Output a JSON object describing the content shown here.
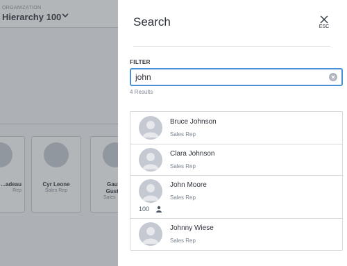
{
  "background": {
    "org_label": "ORGANIZATION",
    "org_name": "Hierarchy 100",
    "cards": [
      {
        "name": "...adeau",
        "role": "Rep"
      },
      {
        "name": "Cyr Leone",
        "role": "Sales Rep"
      },
      {
        "name": "Gauv Gusta",
        "role": "Sales"
      }
    ]
  },
  "panel": {
    "title": "Search",
    "close_label": "ESC",
    "filter_label": "FILTER",
    "filter_value": "john",
    "results_count": "4 Results",
    "results": [
      {
        "name": "Bruce Johnson",
        "role": "Sales Rep"
      },
      {
        "name": "Clara Johnson",
        "role": "Sales Rep"
      },
      {
        "name": "John Moore",
        "role": "Sales Rep",
        "count": "100"
      },
      {
        "name": "Johnny Wiese",
        "role": "Sales Rep"
      }
    ]
  },
  "colors": {
    "accent": "#4a90d9",
    "overlay": "#4b5058",
    "avatar": "#c5cad2"
  },
  "icons": {
    "close": "close-icon",
    "clear": "clear-icon",
    "chevron": "chevron-down-icon",
    "avatar": "avatar-icon",
    "person": "person-icon"
  }
}
